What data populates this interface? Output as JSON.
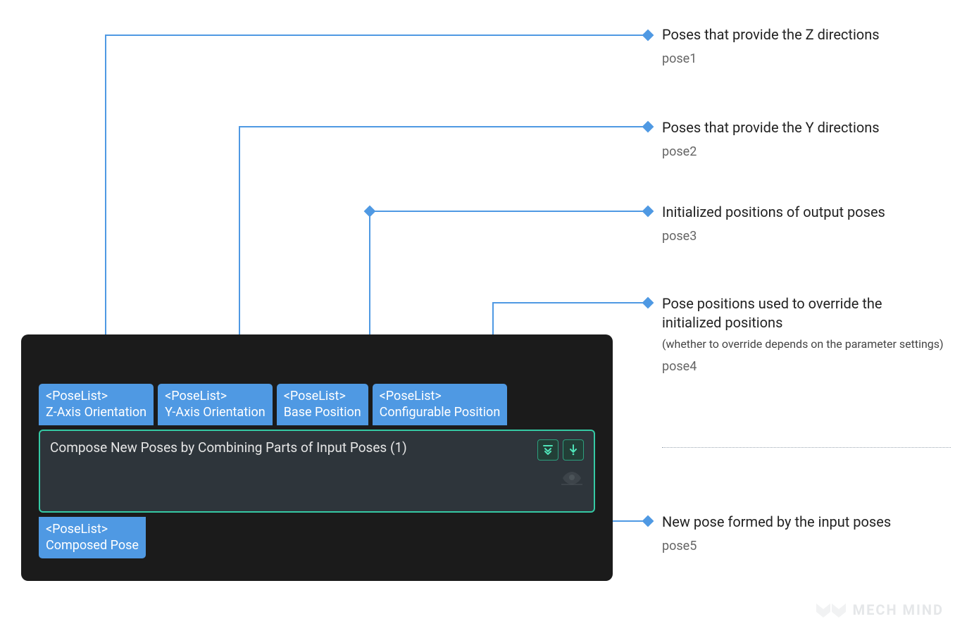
{
  "annotations": [
    {
      "title": "Poses that provide the Z directions",
      "sub": "",
      "tag": "pose1"
    },
    {
      "title": "Poses that provide the Y directions",
      "sub": "",
      "tag": "pose2"
    },
    {
      "title": "Initialized positions of output poses",
      "sub": "",
      "tag": "pose3"
    },
    {
      "title": "Pose positions used to override the initialized positions",
      "sub": "(whether to override depends on the parameter settings)",
      "tag": "pose4"
    },
    {
      "title": "New pose formed by the input poses",
      "sub": "",
      "tag": "pose5"
    }
  ],
  "ports_in": [
    {
      "type": "<PoseList>",
      "name": "Z-Axis Orientation"
    },
    {
      "type": "<PoseList>",
      "name": "Y-Axis Orientation"
    },
    {
      "type": "<PoseList>",
      "name": "Base Position"
    },
    {
      "type": "<PoseList>",
      "name": "Configurable Position"
    }
  ],
  "node_title": "Compose New Poses by Combining Parts of Input Poses (1)",
  "port_out": {
    "type": "<PoseList>",
    "name": "Composed Pose"
  },
  "watermark": "MECH MIND"
}
